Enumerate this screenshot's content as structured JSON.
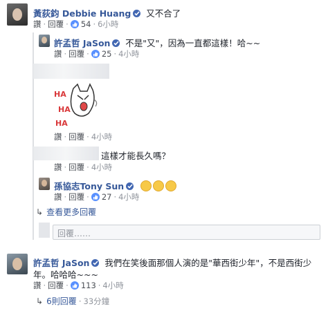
{
  "comments": [
    {
      "name": "黃荻鈞 Debbie Huang",
      "text": "又不合了",
      "actions": {
        "read": "讚",
        "reply": "回覆",
        "likes": "54",
        "time": "6小時"
      }
    },
    {
      "name": "許孟哲 JaSon",
      "text": "不是\"又\"，因為一直都這樣！哈~~",
      "actions": {
        "read": "讚",
        "reply": "回覆",
        "likes": "25",
        "time": "4小時"
      }
    },
    {
      "sticker_text": "HA HA HA",
      "actions": {
        "read": "讚",
        "reply": "回覆",
        "time": "4小時"
      }
    },
    {
      "text": "這樣才能長久嗎？",
      "actions": {
        "read": "讚",
        "reply": "回覆",
        "time": "4小時"
      }
    },
    {
      "name": "孫協志Tony Sun",
      "actions": {
        "read": "讚",
        "reply": "回覆",
        "likes": "27",
        "time": "4小時"
      }
    },
    {
      "name": "許孟哲 JaSon",
      "text_line1": "我們在笑後面那個人演的是\"華西街少年\"，不是西街少",
      "text_line2": "年。哈哈哈~~~",
      "actions": {
        "read": "讚",
        "reply": "回覆",
        "likes": "113",
        "time": "4小時"
      }
    }
  ],
  "more_replies": "查看更多回覆",
  "reply_placeholder": "回覆……",
  "reply_summary": {
    "label": "6則回覆",
    "time": "33分鐘"
  },
  "colors": {
    "name": "#365899",
    "like": "#5890ff",
    "verified": "#4267b2"
  }
}
